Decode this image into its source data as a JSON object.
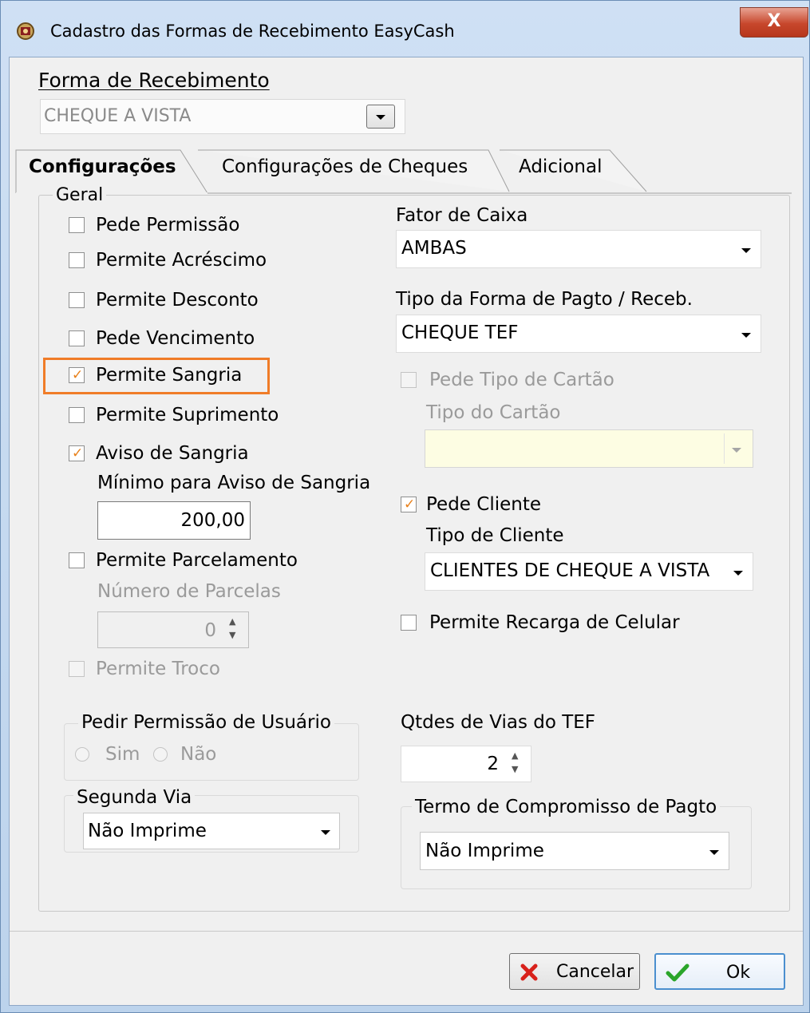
{
  "window": {
    "title": "Cadastro das Formas de Recebimento EasyCash",
    "close_label": "X"
  },
  "forma": {
    "label": "Forma de Recebimento",
    "value": "CHEQUE A VISTA"
  },
  "tabs": [
    {
      "label": "Configurações",
      "active": true
    },
    {
      "label": "Configurações de Cheques",
      "active": false
    },
    {
      "label": "Adicional",
      "active": false
    }
  ],
  "geral": {
    "title": "Geral",
    "pede_permissao": "Pede Permissão",
    "permite_acrescimo": "Permite Acréscimo",
    "permite_desconto": "Permite Desconto",
    "pede_vencimento": "Pede Vencimento",
    "permite_sangria": "Permite Sangria",
    "permite_suprimento": "Permite Suprimento",
    "aviso_sangria": "Aviso de Sangria",
    "minimo_label": "Mínimo para Aviso de Sangria",
    "minimo_value": "200,00",
    "permite_parcelamento": "Permite Parcelamento",
    "numero_parcelas_label": "Número de Parcelas",
    "numero_parcelas_value": "0",
    "permite_troco": "Permite Troco"
  },
  "right": {
    "fator_label": "Fator de Caixa",
    "fator_value": "AMBAS",
    "tipo_forma_label": "Tipo da Forma de Pagto / Receb.",
    "tipo_forma_value": "CHEQUE TEF",
    "pede_tipo_cartao": "Pede Tipo de Cartão",
    "tipo_cartao_label": "Tipo do Cartão",
    "tipo_cartao_value": "",
    "pede_cliente": "Pede Cliente",
    "tipo_cliente_label": "Tipo de Cliente",
    "tipo_cliente_value": "CLIENTES DE CHEQUE A VISTA",
    "permite_recarga": "Permite Recarga de Celular"
  },
  "permissao": {
    "title": "Pedir Permissão de Usuário",
    "sim": "Sim",
    "nao": "Não"
  },
  "qtdes": {
    "label": "Qtdes de Vias do TEF",
    "value": "2"
  },
  "segunda_via": {
    "title": "Segunda Via",
    "value": "Não Imprime"
  },
  "termo": {
    "title": "Termo de Compromisso de Pagto",
    "value": "Não Imprime"
  },
  "buttons": {
    "cancel": "Cancelar",
    "ok": "Ok"
  },
  "colors": {
    "highlight": "#f07c28",
    "check": "#e8801a",
    "cancel_icon": "#d8211b",
    "ok_icon": "#2aa52a"
  }
}
